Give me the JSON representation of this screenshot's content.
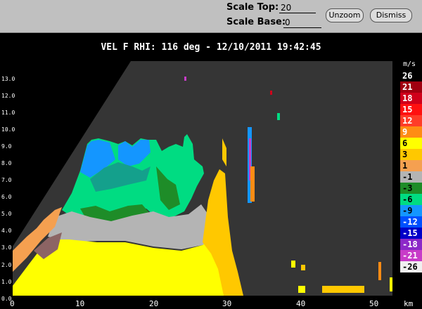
{
  "toolbar": {
    "scale_top_label": "Scale Top:",
    "scale_top_value": "20",
    "scale_base_label": "Scale Base:",
    "scale_base_value": "0",
    "unzoom_label": "Unzoom",
    "dismiss_label": "Dismiss"
  },
  "plot_title": "VEL F  RHI: 116 deg  -  12/10/2011 19:42:45",
  "y_axis": {
    "ticks": [
      "13.0",
      "12.0",
      "11.0",
      "10.0",
      "9.0",
      "8.0",
      "7.0",
      "6.0",
      "5.0",
      "4.0",
      "3.0",
      "2.0",
      "1.0",
      "0.0"
    ]
  },
  "x_axis": {
    "ticks": [
      "0",
      "10",
      "20",
      "30",
      "40",
      "50"
    ],
    "unit": "km"
  },
  "colorbar": {
    "unit": "m/s",
    "entries": [
      {
        "label": "26",
        "color": "#000000",
        "text": "#ffffff"
      },
      {
        "label": "21",
        "color": "#a00010",
        "text": "#ffffff"
      },
      {
        "label": "18",
        "color": "#d0001a",
        "text": "#ffffff"
      },
      {
        "label": "15",
        "color": "#ff1010",
        "text": "#ffffff"
      },
      {
        "label": "12",
        "color": "#ff3c28",
        "text": "#ffffff"
      },
      {
        "label": "9",
        "color": "#ff8c14",
        "text": "#ffffff"
      },
      {
        "label": "6",
        "color": "#ffff00",
        "text": "#000000"
      },
      {
        "label": "3",
        "color": "#ffc800",
        "text": "#000000"
      },
      {
        "label": "1",
        "color": "#f5a050",
        "text": "#000000"
      },
      {
        "label": "-1",
        "color": "#b4b4b4",
        "text": "#000000"
      },
      {
        "label": "-3",
        "color": "#1e8c28",
        "text": "#000000"
      },
      {
        "label": "-6",
        "color": "#00dc82",
        "text": "#000000"
      },
      {
        "label": "-9",
        "color": "#1496ff",
        "text": "#000000"
      },
      {
        "label": "-12",
        "color": "#0050ff",
        "text": "#ffffff"
      },
      {
        "label": "-15",
        "color": "#0000c8",
        "text": "#ffffff"
      },
      {
        "label": "-18",
        "color": "#8c28c8",
        "text": "#ffffff"
      },
      {
        "label": "-21",
        "color": "#c83cc8",
        "text": "#ffffff"
      },
      {
        "label": "-26",
        "color": "#f0f0f0",
        "text": "#000000"
      }
    ]
  }
}
